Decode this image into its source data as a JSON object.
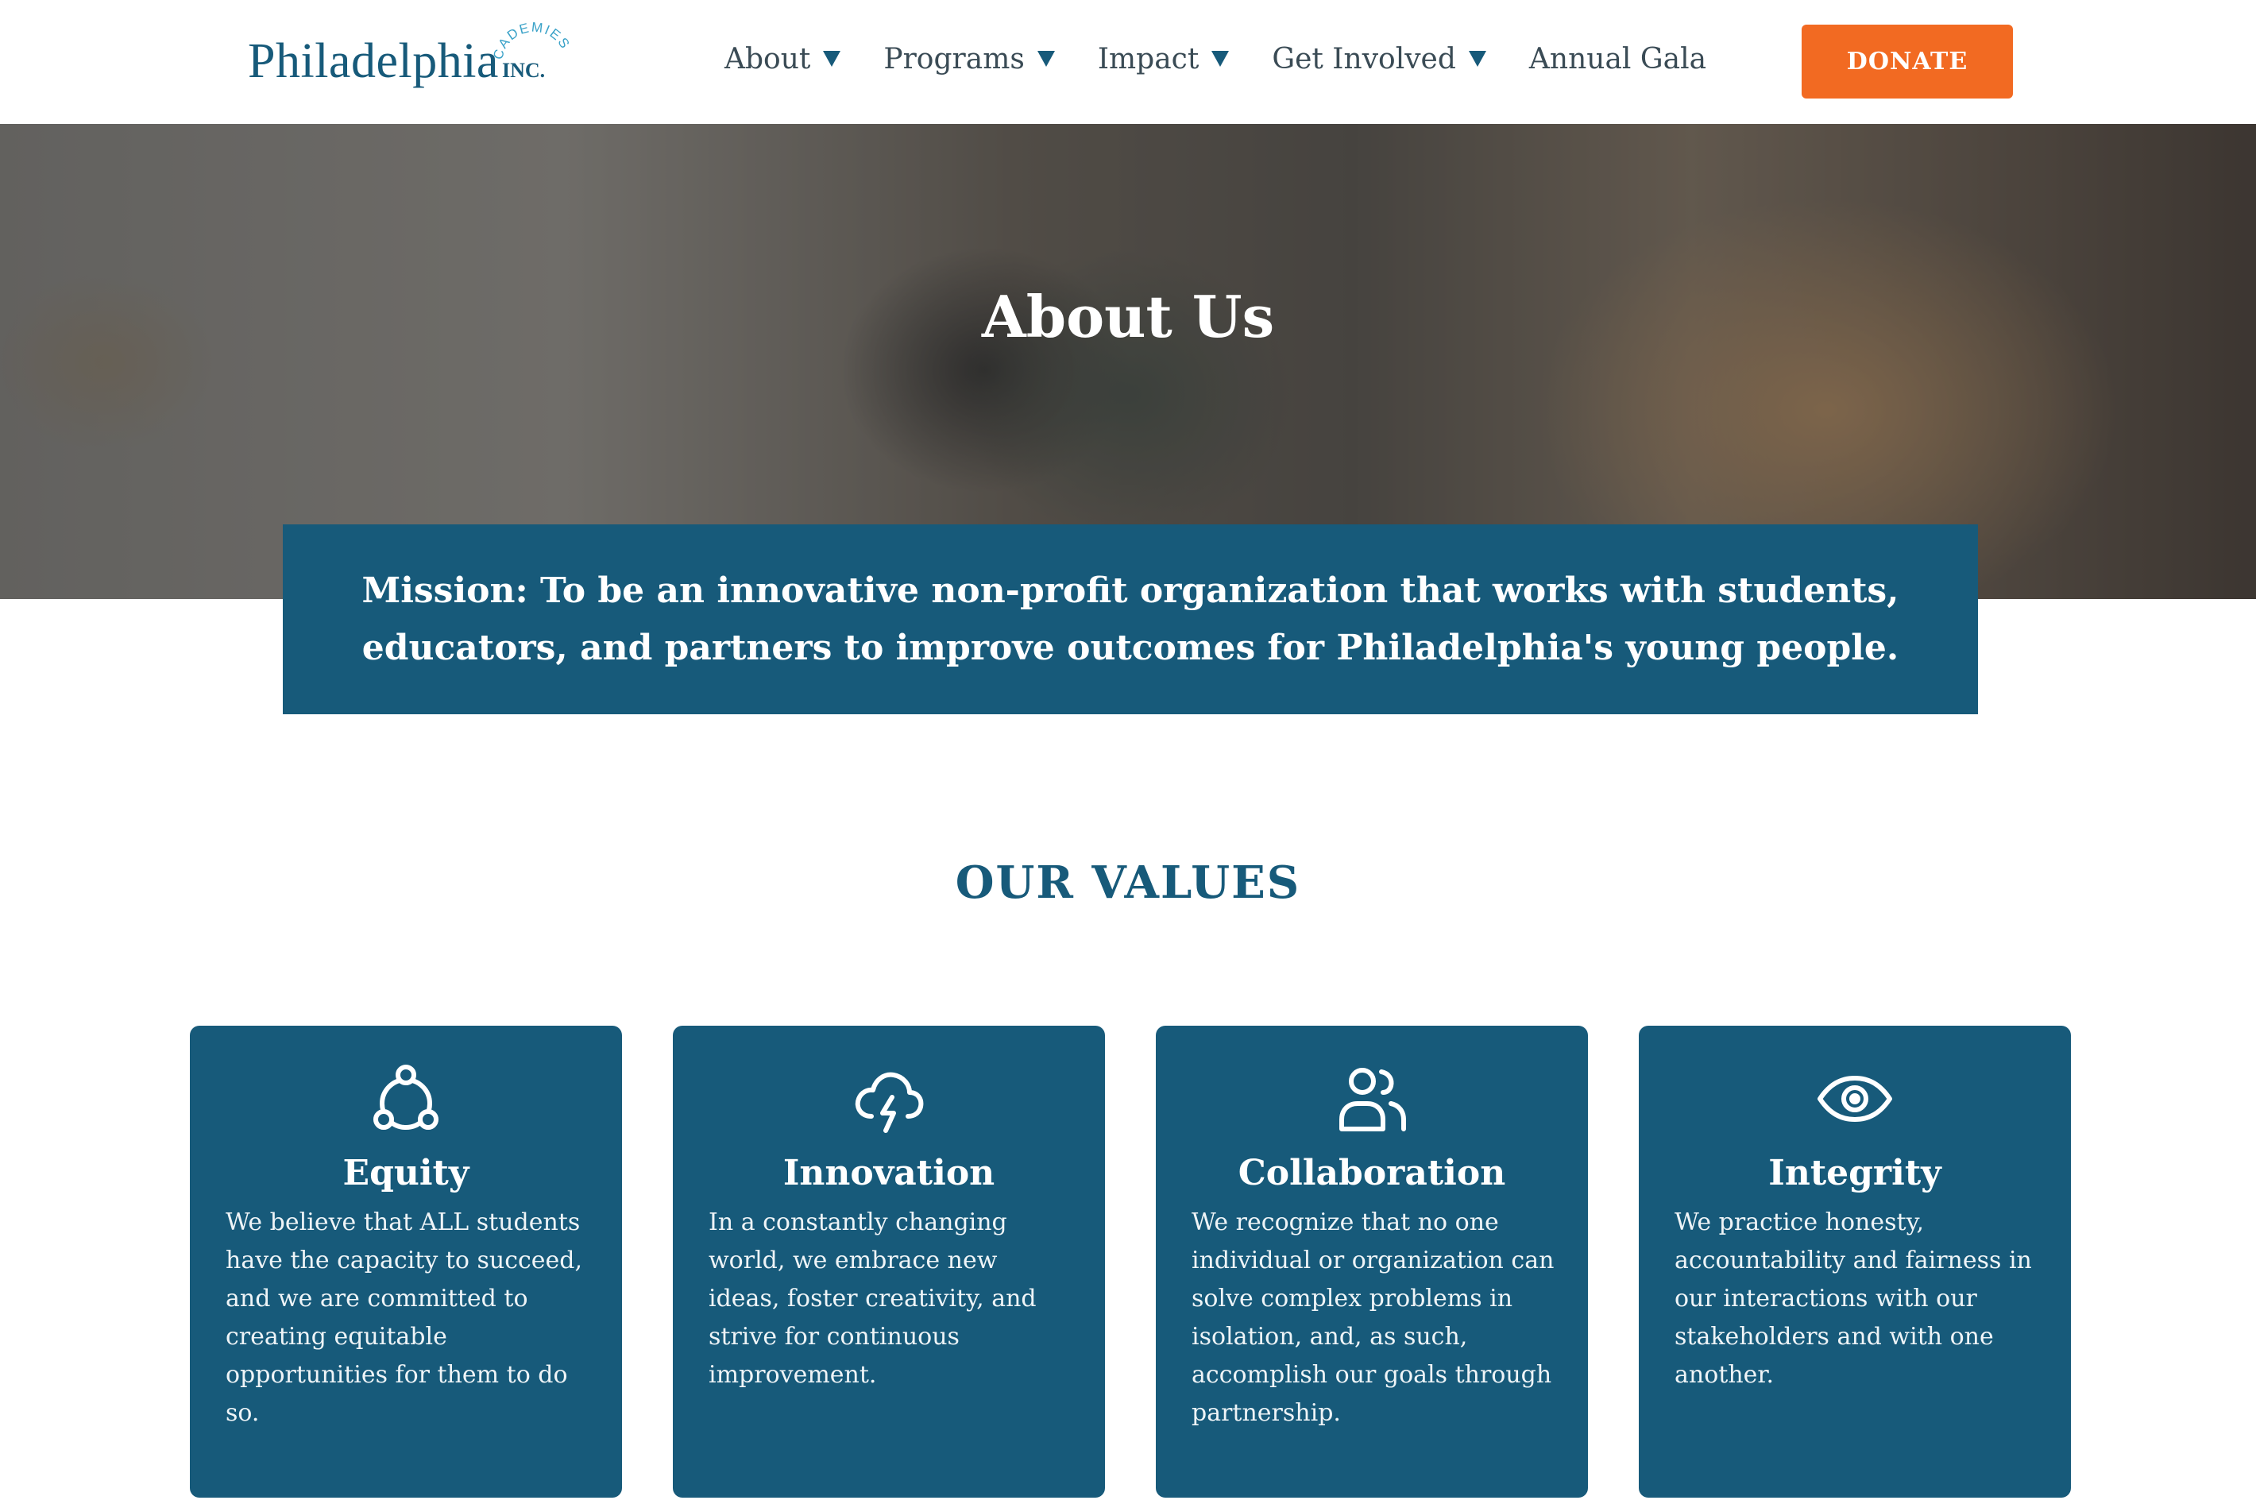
{
  "header": {
    "logo": {
      "wordmark": "Philadelphia",
      "arc_text": "CADEMIES",
      "inc": "INC."
    },
    "nav": [
      {
        "label": "About",
        "has_dropdown": true
      },
      {
        "label": "Programs",
        "has_dropdown": true
      },
      {
        "label": "Impact",
        "has_dropdown": true
      },
      {
        "label": "Get Involved",
        "has_dropdown": true
      },
      {
        "label": "Annual Gala",
        "has_dropdown": false
      }
    ],
    "donate_label": "DONATE"
  },
  "hero": {
    "title": "About Us"
  },
  "mission": {
    "text": "Mission: To be an innovative non-profit organization that works with students, educators, and partners to improve outcomes for Philadelphia's young people."
  },
  "values": {
    "title": "OUR VALUES",
    "items": [
      {
        "icon": "equity-network-icon",
        "title": "Equity",
        "text": "We believe that ALL students have the capacity to succeed, and we are committed to creating equitable opportunities for them to do so."
      },
      {
        "icon": "cloud-lightning-icon",
        "title": "Innovation",
        "text": "In a constantly changing world, we embrace new ideas, foster creativity, and strive for continuous improvement."
      },
      {
        "icon": "users-icon",
        "title": "Collaboration",
        "text": "We recognize that no one individual or organization can solve complex problems in isolation, and, as such, accomplish our goals through partnership."
      },
      {
        "icon": "eye-icon",
        "title": "Integrity",
        "text": "We practice honesty, accountability and fairness in our interactions with our stakeholders and with one another."
      }
    ]
  },
  "colors": {
    "brand_blue": "#175a7a",
    "donate_orange": "#f26a22",
    "white": "#ffffff"
  }
}
